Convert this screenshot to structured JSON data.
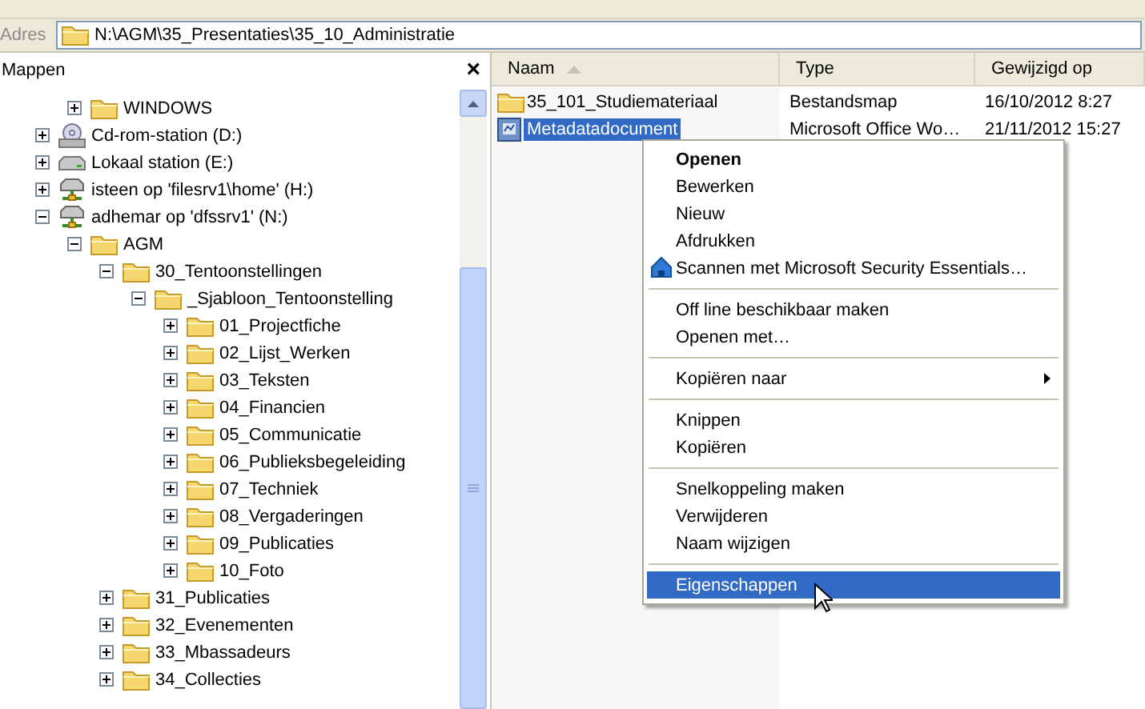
{
  "address_bar": {
    "label": "Adres",
    "path": "N:\\AGM\\35_Presentaties\\35_10_Administratie"
  },
  "folders_pane": {
    "title": "Mappen",
    "close": "×",
    "tree": [
      {
        "children": [
          {
            "label": "WINDOWS",
            "kind": "folder",
            "expanded": false
          }
        ]
      },
      {
        "label": "Cd-rom-station (D:)",
        "kind": "cdrom",
        "expanded": false
      },
      {
        "label": "Lokaal station (E:)",
        "kind": "drive",
        "expanded": false
      },
      {
        "label": "isteen op 'filesrv1\\home' (H:)",
        "kind": "network",
        "expanded": false
      },
      {
        "label": "adhemar op 'dfssrv1' (N:)",
        "kind": "network",
        "expanded": true,
        "children": [
          {
            "label": "AGM",
            "kind": "folder",
            "expanded": true,
            "children": [
              {
                "label": "30_Tentoonstellingen",
                "kind": "folder",
                "expanded": true,
                "children": [
                  {
                    "label": "_Sjabloon_Tentoonstelling",
                    "kind": "folder",
                    "expanded": true,
                    "children": [
                      {
                        "label": "01_Projectfiche",
                        "kind": "folder",
                        "expanded": false
                      },
                      {
                        "label": "02_Lijst_Werken",
                        "kind": "folder",
                        "expanded": false
                      },
                      {
                        "label": "03_Teksten",
                        "kind": "folder",
                        "expanded": false
                      },
                      {
                        "label": "04_Financien",
                        "kind": "folder",
                        "expanded": false
                      },
                      {
                        "label": "05_Communicatie",
                        "kind": "folder",
                        "expanded": false
                      },
                      {
                        "label": "06_Publieksbegeleiding",
                        "kind": "folder",
                        "expanded": false
                      },
                      {
                        "label": "07_Techniek",
                        "kind": "folder",
                        "expanded": false
                      },
                      {
                        "label": "08_Vergaderingen",
                        "kind": "folder",
                        "expanded": false
                      },
                      {
                        "label": "09_Publicaties",
                        "kind": "folder",
                        "expanded": false
                      },
                      {
                        "label": "10_Foto",
                        "kind": "folder",
                        "expanded": false
                      }
                    ]
                  }
                ]
              },
              {
                "label": "31_Publicaties",
                "kind": "folder",
                "expanded": false
              },
              {
                "label": "32_Evenementen",
                "kind": "folder",
                "expanded": false
              },
              {
                "label": "33_Mbassadeurs",
                "kind": "folder",
                "expanded": false
              },
              {
                "label": "34_Collecties",
                "kind": "folder",
                "expanded": false
              }
            ]
          }
        ]
      }
    ]
  },
  "file_list": {
    "columns": [
      {
        "label": "Naam",
        "sorted": true
      },
      {
        "label": "Type",
        "sorted": false
      },
      {
        "label": "Gewijzigd op",
        "sorted": false
      }
    ],
    "rows": [
      {
        "name": "35_101_Studiemateriaal",
        "kind": "folder",
        "type": "Bestandsmap",
        "modified": "16/10/2012 8:27",
        "selected": false
      },
      {
        "name": "Metadatadocument",
        "kind": "document",
        "type": "Microsoft Office Wo…",
        "modified": "21/11/2012 15:27",
        "selected": true
      }
    ]
  },
  "context_menu": {
    "items": [
      {
        "kind": "item",
        "label": "Openen",
        "bold": true,
        "selected": false
      },
      {
        "kind": "item",
        "label": "Bewerken",
        "selected": false
      },
      {
        "kind": "item",
        "label": "Nieuw",
        "selected": false
      },
      {
        "kind": "item",
        "label": "Afdrukken",
        "selected": false
      },
      {
        "kind": "item",
        "label": "Scannen met Microsoft Security Essentials…",
        "has_icon": true,
        "selected": false
      },
      {
        "kind": "separator"
      },
      {
        "kind": "item",
        "label": "Off line beschikbaar maken",
        "selected": false
      },
      {
        "kind": "item",
        "label": "Openen met…",
        "selected": false
      },
      {
        "kind": "separator"
      },
      {
        "kind": "item",
        "label": "Kopiëren naar",
        "submenu": true,
        "selected": false
      },
      {
        "kind": "separator"
      },
      {
        "kind": "item",
        "label": "Knippen",
        "selected": false
      },
      {
        "kind": "item",
        "label": "Kopiëren",
        "selected": false
      },
      {
        "kind": "separator"
      },
      {
        "kind": "item",
        "label": "Snelkoppeling maken",
        "selected": false
      },
      {
        "kind": "item",
        "label": "Verwijderen",
        "selected": false
      },
      {
        "kind": "item",
        "label": "Naam wijzigen",
        "selected": false
      },
      {
        "kind": "separator"
      },
      {
        "kind": "item",
        "label": "Eigenschappen",
        "selected": true
      }
    ]
  }
}
